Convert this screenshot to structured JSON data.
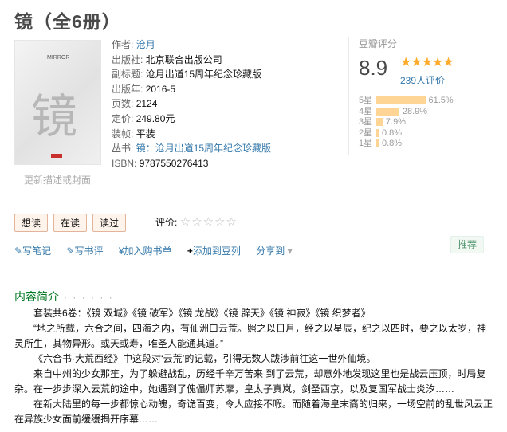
{
  "book": {
    "title": "镜（全6册）",
    "cover_small_text": "MIRROR",
    "cover_big_char": "镜",
    "update_cover": "更新描述或封面"
  },
  "info": [
    {
      "key": "作者:",
      "value": "沧月",
      "link": true
    },
    {
      "key": "出版社:",
      "value": "北京联合出版公司",
      "link": false
    },
    {
      "key": "副标题:",
      "value": "沧月出道15周年纪念珍藏版",
      "link": false
    },
    {
      "key": "出版年:",
      "value": "2016-5",
      "link": false
    },
    {
      "key": "页数:",
      "value": "2124",
      "link": false
    },
    {
      "key": "定价:",
      "value": "249.80元",
      "link": false
    },
    {
      "key": "装帧:",
      "value": "平装",
      "link": false
    },
    {
      "key": "丛书:",
      "value": "镜：沧月出道15周年纪念珍藏版",
      "link": true
    },
    {
      "key": "ISBN:",
      "value": "9787550276413",
      "link": false
    }
  ],
  "rating": {
    "label": "豆瓣评分",
    "score": "8.9",
    "stars_icon": "star-rating-icon",
    "stars": "★★★★★",
    "count": "239人评价",
    "bars": [
      {
        "label": "5星",
        "pct": "61.5%",
        "value": 61.5
      },
      {
        "label": "4星",
        "pct": "28.9%",
        "value": 28.9
      },
      {
        "label": "3星",
        "pct": "7.9%",
        "value": 7.9
      },
      {
        "label": "2星",
        "pct": "0.8%",
        "value": 0.8
      },
      {
        "label": "1星",
        "pct": "0.8%",
        "value": 0.8
      }
    ],
    "bar_color": "#ffd596"
  },
  "actions": {
    "want": "想读",
    "reading": "在读",
    "read": "读过",
    "rate_label": "评价:",
    "empty_stars": "☆☆☆☆☆"
  },
  "tools": {
    "note": "写笔记",
    "review": "写书评",
    "cart": "加入购书单",
    "doulist": "添加到豆列",
    "share": "分享到",
    "recommend": "推荐"
  },
  "intro": {
    "heading": "内容简介",
    "dots": "· · · · · ·",
    "paragraphs": [
      "套装共6卷：《镜 双城》《镜 破军》《镜 龙战》《镜 辟天》《镜 神寂》《镜 织梦者》",
      "“地之所载，六合之间，四海之内，有仙洲曰云荒。照之以日月，经之以星辰，纪之以四时，要之以太岁，神灵所生，其物异形。或天或寿，唯圣人能通其道。”",
      "《六合书·大荒西经》中这段对‘云荒’的记载，引得无数人跋涉前往这一世外仙境。",
      "来自中州的少女那笙，为了躲避战乱，历经千辛万苦来 到了云荒，却意外地发现这里也是战云压顶，时局复杂。在一步步深入云荒的途中，她遇到了傀儡师苏摩，皇太子真岚，剑圣西京，以及复国军战士炎汐……",
      "在新大陆里的每一步都惊心动魄，奇诡百变，令人应接不暇。而随着海皇末裔的归来，一场空前的乱世风云正在异族少女面前缓缓揭开序幕……"
    ]
  }
}
